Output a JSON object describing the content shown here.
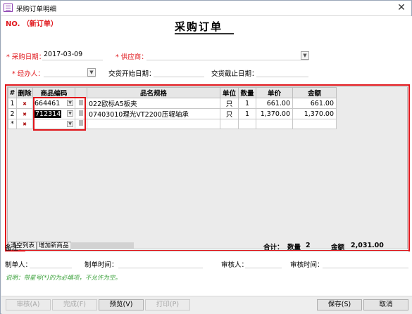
{
  "window": {
    "title": "采购订单明细",
    "close": "✕"
  },
  "header": {
    "order_no": "NO. （新订单）",
    "form_title": "采购订单"
  },
  "fields": {
    "purchase_date_label": "* 采购日期：",
    "purchase_date_value": "2017-03-09",
    "supplier_label": "* 供应商：",
    "supplier_value": "",
    "handler_label": "* 经办人：",
    "handler_value": "",
    "delivery_start_label": "交货开始日期：",
    "delivery_start_value": "",
    "delivery_end_label": "交货截止日期：",
    "delivery_end_value": ""
  },
  "grid": {
    "headers": [
      "#",
      "删除",
      "商品编码",
      "",
      "品名规格",
      "单位",
      "数量",
      "单价",
      "金额"
    ],
    "rows": [
      {
        "num": "1",
        "delete": "✖",
        "code": "664461",
        "name": "022欧标A5板夹",
        "unit": "只",
        "qty": "1",
        "price": "661.00",
        "amount": "661.00"
      },
      {
        "num": "2",
        "delete": "✖",
        "code": "712314",
        "name": "07403010理光VT2200压辊轴承",
        "unit": "只",
        "qty": "1",
        "price": "1,370.00",
        "amount": "1,370.00"
      },
      {
        "num": "*",
        "delete": "✖",
        "code": "",
        "name": "",
        "unit": "",
        "qty": "",
        "price": "",
        "amount": ""
      }
    ],
    "footer": {
      "clear_button": "清空列表",
      "add_button": "增加新商品",
      "total_label": "合计：",
      "qty_label": "数量",
      "qty_value": "2",
      "amount_label": "金额",
      "amount_value": "2,031.00"
    }
  },
  "bottom": {
    "remark_label": "备注：",
    "maker_label": "制单人：",
    "make_time_label": "制单时间：",
    "reviewer_label": "审核人：",
    "review_time_label": "审核时间：",
    "hint": "说明：带星号(*)的为必填项，不允许为空。"
  },
  "actions": {
    "review": "审核(A)",
    "complete": "完成(F)",
    "preview": "预览(V)",
    "print": "打印(P)",
    "save": "保存(S)",
    "cancel": "取消"
  },
  "colors": {
    "accent_red": "#e0161b",
    "hint_green": "#3aa13a"
  },
  "icons": {
    "app": "form-icon",
    "dropdown": "chevron-down-icon",
    "delete": "delete-x-icon"
  }
}
